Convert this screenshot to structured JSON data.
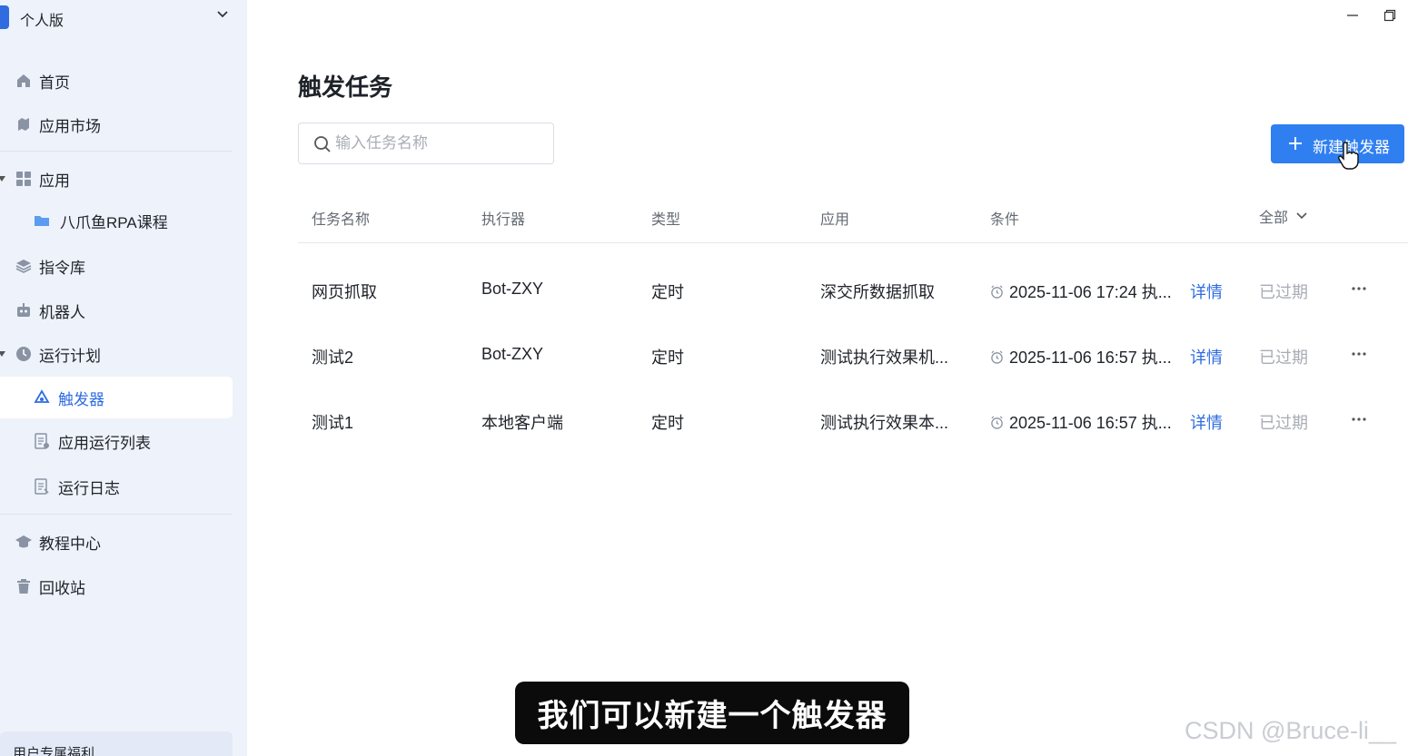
{
  "workspace": {
    "label": "个人版"
  },
  "sidebar": {
    "items": [
      {
        "label": "首页",
        "icon": "home-icon"
      },
      {
        "label": "应用市场",
        "icon": "market-icon"
      },
      {
        "label": "应用",
        "icon": "apps-grid-icon"
      },
      {
        "label": "八爪鱼RPA课程",
        "icon": "folder-icon"
      },
      {
        "label": "指令库",
        "icon": "layers-icon"
      },
      {
        "label": "机器人",
        "icon": "robot-icon"
      },
      {
        "label": "运行计划",
        "icon": "clock-icon"
      },
      {
        "label": "触发器",
        "icon": "trigger-icon",
        "active": true
      },
      {
        "label": "应用运行列表",
        "icon": "run-list-icon"
      },
      {
        "label": "运行日志",
        "icon": "log-icon"
      },
      {
        "label": "教程中心",
        "icon": "graduation-cap-icon"
      },
      {
        "label": "回收站",
        "icon": "trash-icon"
      }
    ],
    "promo": "用户专属福利"
  },
  "main": {
    "title": "触发任务",
    "search": {
      "placeholder": "输入任务名称",
      "value": ""
    },
    "new_button": "新建触发器",
    "table": {
      "headers": [
        "任务名称",
        "执行器",
        "类型",
        "应用",
        "条件"
      ],
      "filter": "全部",
      "rows": [
        {
          "name": "网页抓取",
          "executor": "Bot-ZXY",
          "type": "定时",
          "app": "深交所数据抓取",
          "condition": "2025-11-06 17:24 执...",
          "detail": "详情",
          "status": "已过期"
        },
        {
          "name": "测试2",
          "executor": "Bot-ZXY",
          "type": "定时",
          "app": "测试执行效果机...",
          "condition": "2025-11-06 16:57 执...",
          "detail": "详情",
          "status": "已过期"
        },
        {
          "name": "测试1",
          "executor": "本地客户端",
          "type": "定时",
          "app": "测试执行效果本...",
          "condition": "2025-11-06 16:57 执...",
          "detail": "详情",
          "status": "已过期"
        }
      ]
    }
  },
  "overlay": {
    "subtitle": "我们可以新建一个触发器",
    "watermark": "CSDN @Bruce-li__"
  },
  "colors": {
    "accent": "#2f6ce0",
    "button": "#2f7ff0",
    "sidebar_bg": "#eef2fb",
    "muted": "#a8adb5"
  }
}
